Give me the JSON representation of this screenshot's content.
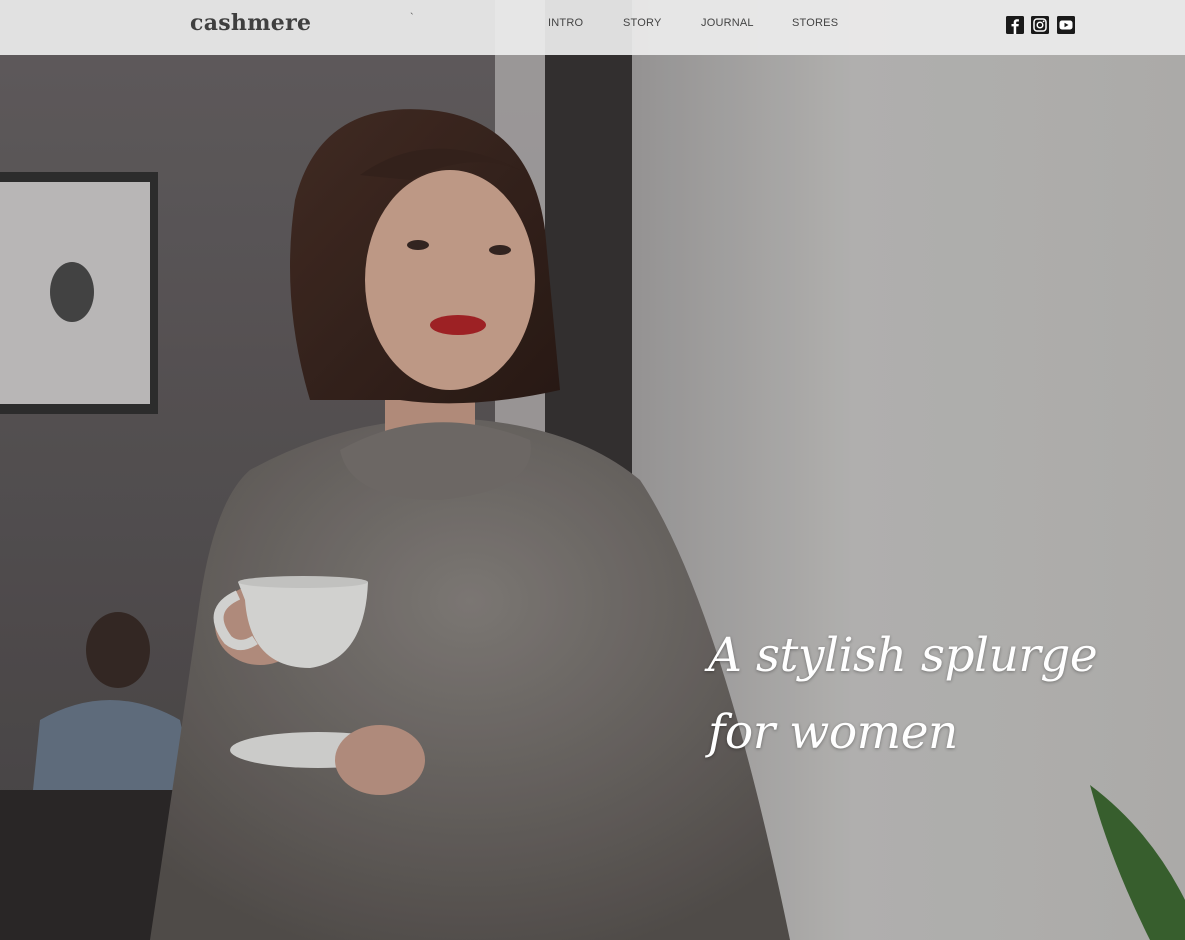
{
  "header": {
    "logo": "cashmere",
    "tick_mark": "`",
    "nav": {
      "intro": "INTRO",
      "story": "STORY",
      "journal": "JOURNAL",
      "stores": "STORES"
    },
    "social_icons": [
      "facebook-icon",
      "instagram-icon",
      "youtube-icon"
    ]
  },
  "hero": {
    "tagline_line1": "A stylish splurge",
    "tagline_line2": "for women",
    "image_alt_subject": "woman in grey sweater holding a white cup by a window"
  },
  "colors": {
    "header_bg": "#ececec",
    "logo_text": "#3f3f3f",
    "nav_text": "#444444",
    "tagline_text": "#ffffff",
    "icon_fill": "#1a1a1a"
  }
}
